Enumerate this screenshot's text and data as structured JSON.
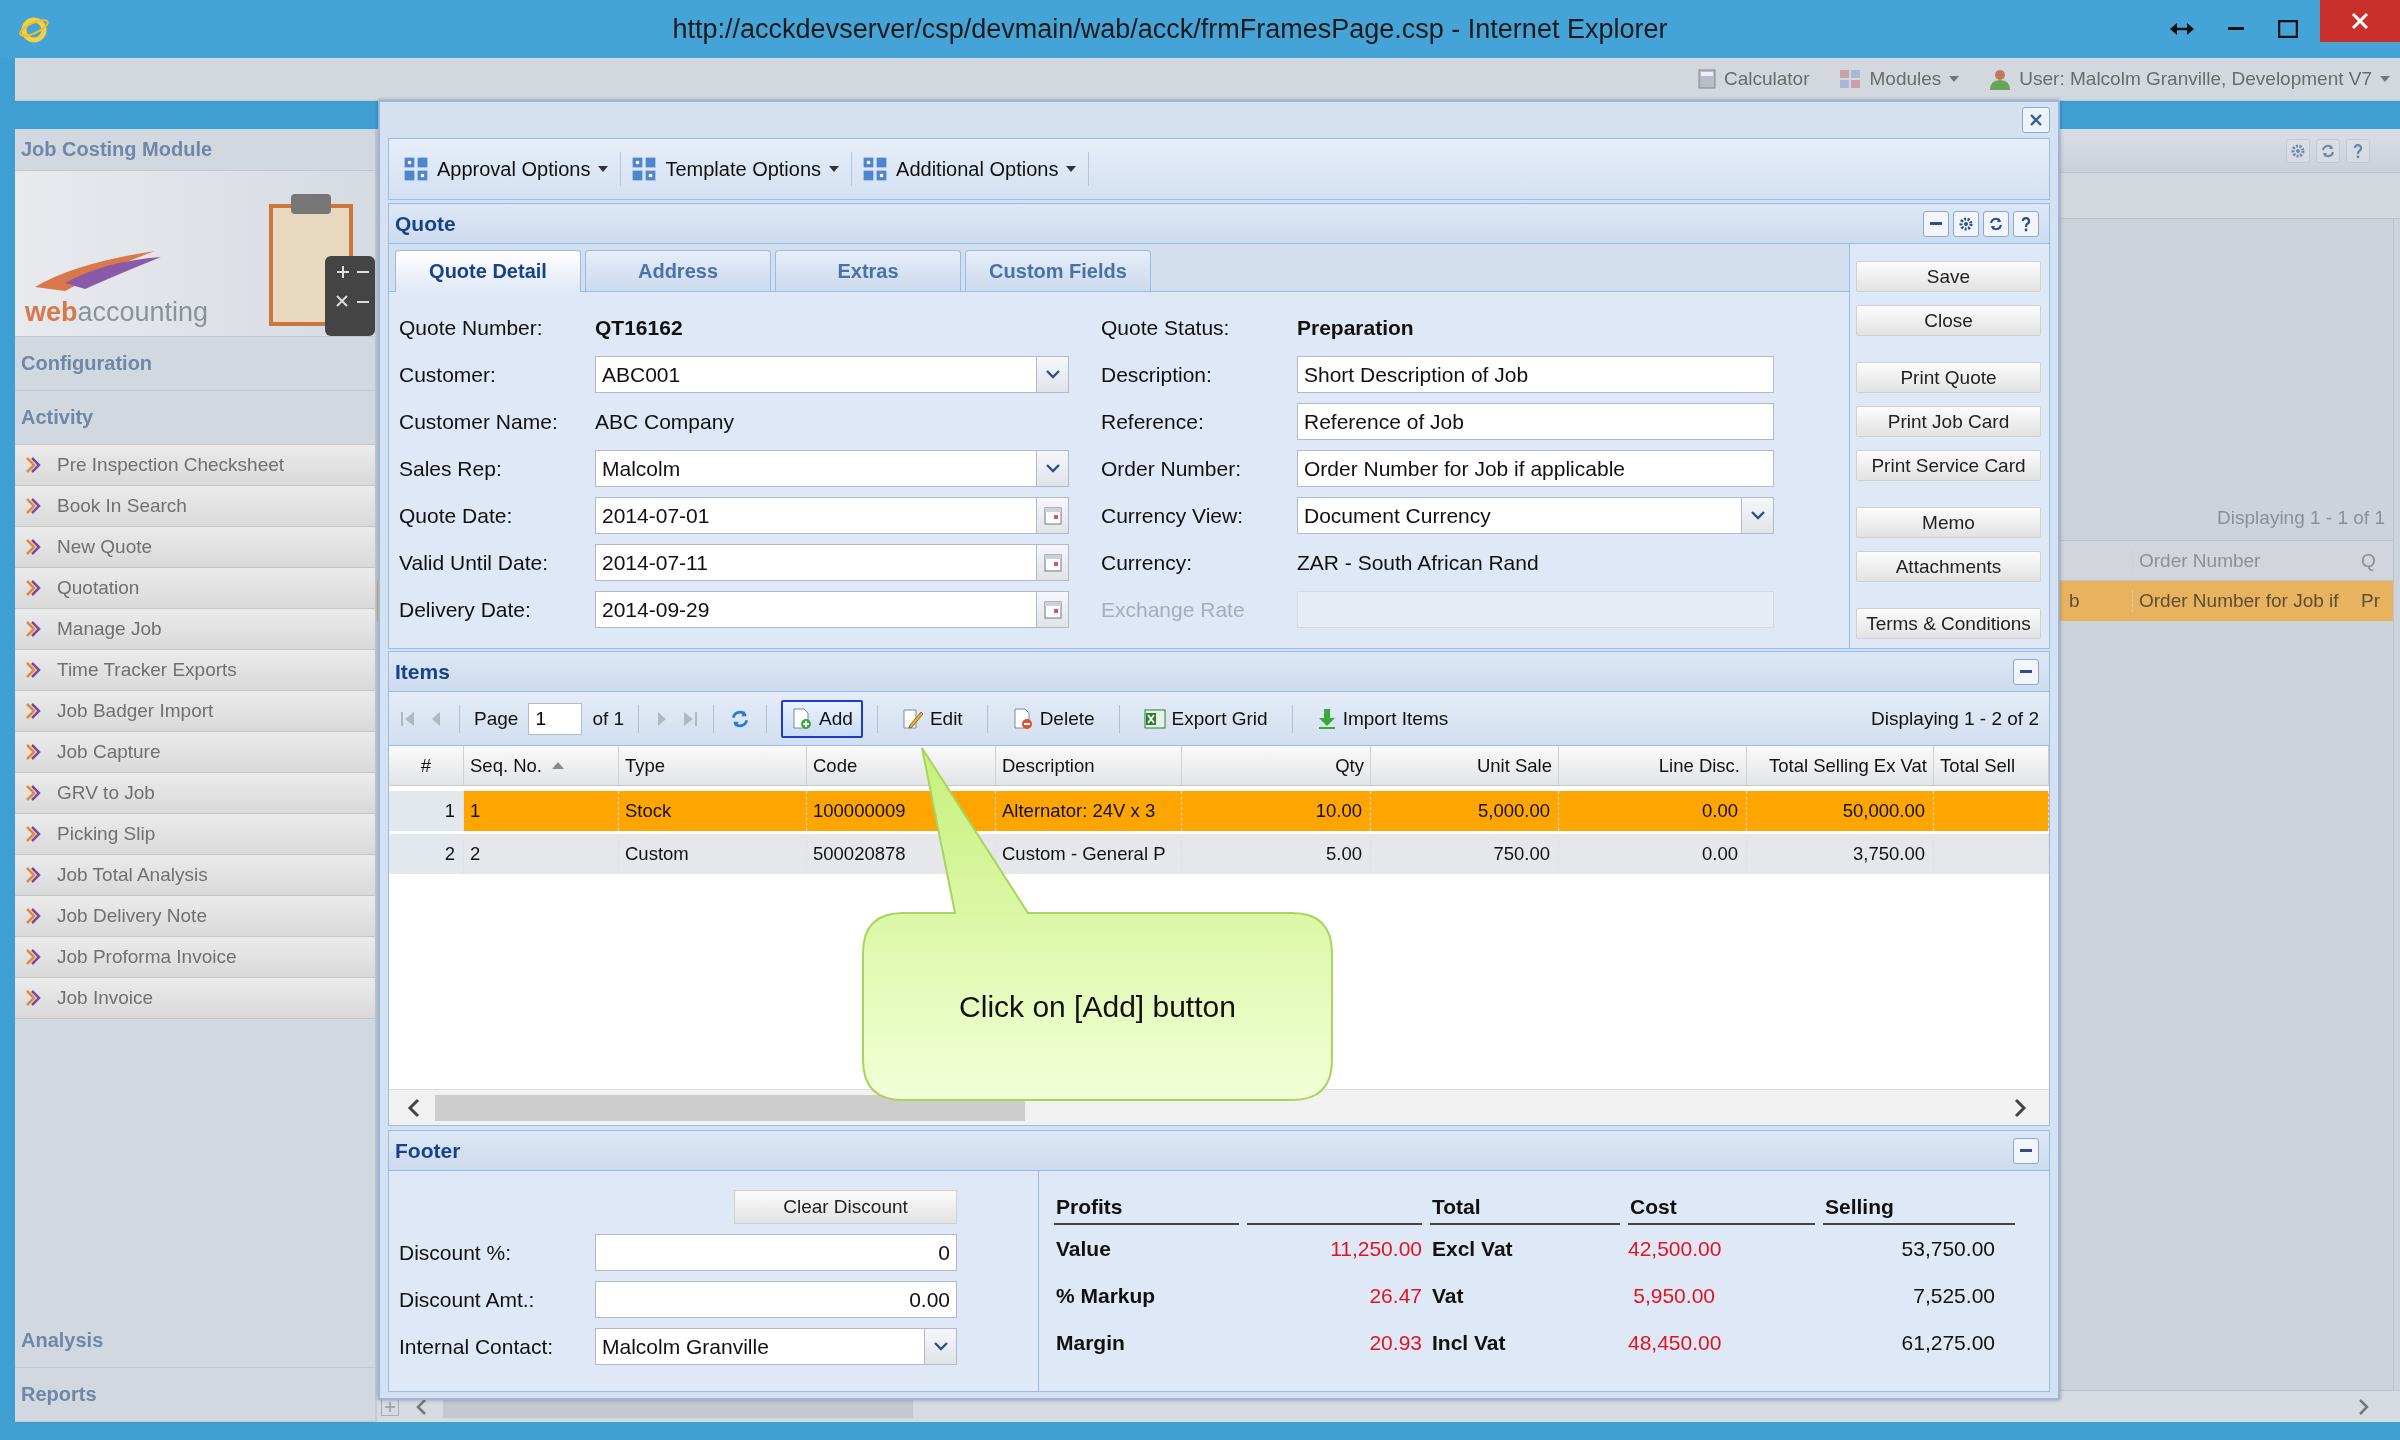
{
  "window": {
    "title": "http://acckdevserver/csp/devmain/wab/acck/frmFramesPage.csp - Internet Explorer"
  },
  "top_bar": [
    {
      "label": "Calculator",
      "kind": "calculator",
      "menu": false
    },
    {
      "label": "Modules",
      "kind": "modules",
      "menu": true
    },
    {
      "label": "User: Malcolm Granville, Development V7",
      "kind": "user",
      "menu": true
    }
  ],
  "sidebar": {
    "title": "Job Costing Module",
    "logo": "**web**accounting",
    "sections": [
      {
        "label": "Configuration"
      },
      {
        "label": "Activity"
      }
    ],
    "items": [
      "Pre Inspection Checksheet",
      "Book In Search",
      "New Quote",
      "Quotation",
      "Manage Job",
      "Time Tracker Exports",
      "Job Badger Import",
      "Job Capture",
      "GRV to Job",
      "Picking Slip",
      "Job Total Analysis",
      "Job Delivery Note",
      "Job Proforma Invoice",
      "Job Invoice"
    ],
    "bottom_sections": [
      {
        "label": "Analysis"
      },
      {
        "label": "Reports"
      }
    ]
  },
  "background": {
    "status": "Displaying 1 - 1 of 1",
    "columns": [
      "Order Number",
      "Q"
    ],
    "row": {
      "selected": true,
      "cells": [
        "b",
        "Order Number for Job if",
        "Pr"
      ]
    }
  },
  "dialog": {
    "menus": [
      {
        "label": "Approval Options"
      },
      {
        "label": "Template Options"
      },
      {
        "label": "Additional Options"
      }
    ],
    "quote": {
      "title": "Quote",
      "tabs": [
        {
          "label": "Quote Detail",
          "selected": true
        },
        {
          "label": "Address",
          "selected": false
        },
        {
          "label": "Extras",
          "selected": false
        },
        {
          "label": "Custom Fields",
          "selected": false
        }
      ],
      "left_fields": [
        {
          "label": "Quote Number:",
          "value": "QT16162",
          "kind": "bold"
        },
        {
          "label": "Customer:",
          "value": "ABC001",
          "kind": "combo"
        },
        {
          "label": "Customer Name:",
          "value": "ABC Company",
          "kind": "text"
        },
        {
          "label": "Sales Rep:",
          "value": "Malcolm",
          "kind": "combo"
        },
        {
          "label": "Quote Date:",
          "value": "2014-07-01",
          "kind": "date"
        },
        {
          "label": "Valid Until Date:",
          "value": "2014-07-11",
          "kind": "date"
        },
        {
          "label": "Delivery Date:",
          "value": "2014-09-29",
          "kind": "date"
        }
      ],
      "right_fields": [
        {
          "label": "Quote Status:",
          "value": "Preparation",
          "kind": "bold",
          "disabled": false
        },
        {
          "label": "Description:",
          "value": "Short Description of Job",
          "kind": "input",
          "disabled": false
        },
        {
          "label": "Reference:",
          "value": "Reference of Job",
          "kind": "input",
          "disabled": false
        },
        {
          "label": "Order Number:",
          "value": "Order Number for Job if applicable",
          "kind": "input",
          "disabled": false
        },
        {
          "label": "Currency View:",
          "value": "Document Currency",
          "kind": "combo",
          "disabled": false
        },
        {
          "label": "Currency:",
          "value": "ZAR - South African Rand",
          "kind": "text",
          "disabled": false
        },
        {
          "label": "Exchange Rate",
          "kind": "input",
          "disabled": true
        }
      ],
      "buttons": [
        "Save",
        "Close",
        "Print Quote",
        "Print Job Card",
        "Print Service Card",
        "Memo",
        "Attachments",
        "Terms & Conditions"
      ]
    },
    "items": {
      "title": "Items",
      "pager": {
        "label": "Page",
        "value": "1",
        "total": "of 1"
      },
      "actions": [
        {
          "label": "Add",
          "kind": "add",
          "focused": true
        },
        {
          "label": "Edit",
          "kind": "edit",
          "focused": false
        },
        {
          "label": "Delete",
          "kind": "delete",
          "focused": false
        },
        {
          "label": "Export Grid",
          "kind": "export",
          "focused": false
        },
        {
          "label": "Import Items",
          "kind": "import",
          "focused": false
        }
      ],
      "status": "Displaying 1 - 2 of 2",
      "columns": [
        {
          "label": "#",
          "sorted": false
        },
        {
          "label": "Seq. No.",
          "sorted": true
        },
        {
          "label": "Type",
          "sorted": false
        },
        {
          "label": "Code",
          "sorted": false
        },
        {
          "label": "Description",
          "sorted": false
        },
        {
          "label": "Qty",
          "sorted": false
        },
        {
          "label": "Unit Sale",
          "sorted": false
        },
        {
          "label": "Line Disc.",
          "sorted": false
        },
        {
          "label": "Total Selling Ex Vat",
          "sorted": false
        },
        {
          "label": "Total Sell",
          "sorted": false
        }
      ],
      "rows": [
        {
          "selected": true,
          "cells": [
            "1",
            "1",
            "Stock",
            "100000009",
            "Alternator: 24V x 3",
            "10.00",
            "5,000.00",
            "0.00",
            "50,000.00"
          ]
        },
        {
          "selected": false,
          "cells": [
            "2",
            "2",
            "Custom",
            "500020878",
            "Custom - General P",
            "5.00",
            "750.00",
            "0.00",
            "3,750.00"
          ]
        }
      ],
      "callout": "Click on [Add] button"
    },
    "footer": {
      "title": "Footer",
      "clear_button": "Clear Discount",
      "fields": [
        {
          "label": "Discount %:",
          "value": "0",
          "kind": "number"
        },
        {
          "label": "Discount Amt.:",
          "value": "0.00",
          "kind": "number"
        },
        {
          "label": "Internal Contact:",
          "value": "Malcolm Granville",
          "kind": "combo"
        }
      ],
      "summary": {
        "headers": [
          "Profits",
          "Total",
          "Cost",
          "Selling"
        ],
        "rows": [
          {
            "label": "Value",
            "profit": "11,250.00",
            "total_label": "Excl Vat",
            "cost": "42,500.00",
            "selling": "53,750.00"
          },
          {
            "label": "% Markup",
            "profit": "26.47",
            "total_label": "Vat",
            "cost": "5,950.00",
            "selling": "7,525.00"
          },
          {
            "label": "Margin",
            "profit": "20.93",
            "total_label": "Incl Vat",
            "cost": "48,450.00",
            "selling": "61,275.00"
          }
        ]
      }
    }
  }
}
